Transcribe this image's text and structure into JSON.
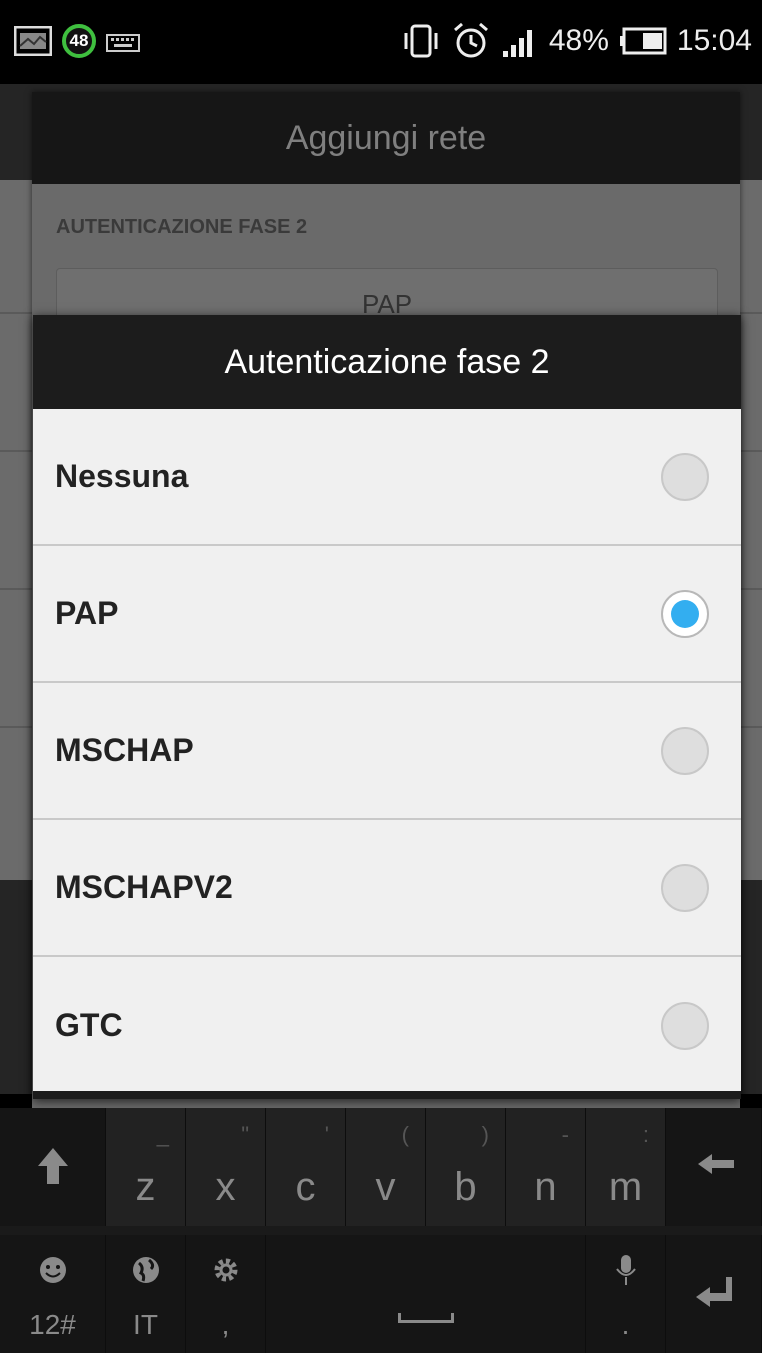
{
  "status_bar": {
    "badge": "48",
    "battery_percent": "48%",
    "time": "15:04",
    "icons": [
      "screenshot-icon",
      "keyboard-icon",
      "vibrate-icon",
      "alarm-icon",
      "signal-icon",
      "battery-icon"
    ]
  },
  "outer_dialog": {
    "title": "Aggiungi rete",
    "section_label": "AUTENTICAZIONE FASE 2",
    "field_value": "PAP"
  },
  "dialog": {
    "title": "Autenticazione fase 2",
    "options": [
      {
        "label": "Nessuna",
        "selected": false
      },
      {
        "label": "PAP",
        "selected": true
      },
      {
        "label": "MSCHAP",
        "selected": false
      },
      {
        "label": "MSCHAPV2",
        "selected": false
      },
      {
        "label": "GTC",
        "selected": false
      }
    ],
    "accent_color": "#33aef0"
  },
  "keyboard": {
    "row1": [
      {
        "main": "z",
        "sub": "_"
      },
      {
        "main": "x",
        "sub": "\""
      },
      {
        "main": "c",
        "sub": "'"
      },
      {
        "main": "v",
        "sub": "("
      },
      {
        "main": "b",
        "sub": ")"
      },
      {
        "main": "n",
        "sub": "-"
      },
      {
        "main": "m",
        "sub": ":"
      }
    ],
    "row2": {
      "emoji_label": "12#",
      "language_label": "IT",
      "settings_label": ",",
      "mic_label": "."
    }
  }
}
